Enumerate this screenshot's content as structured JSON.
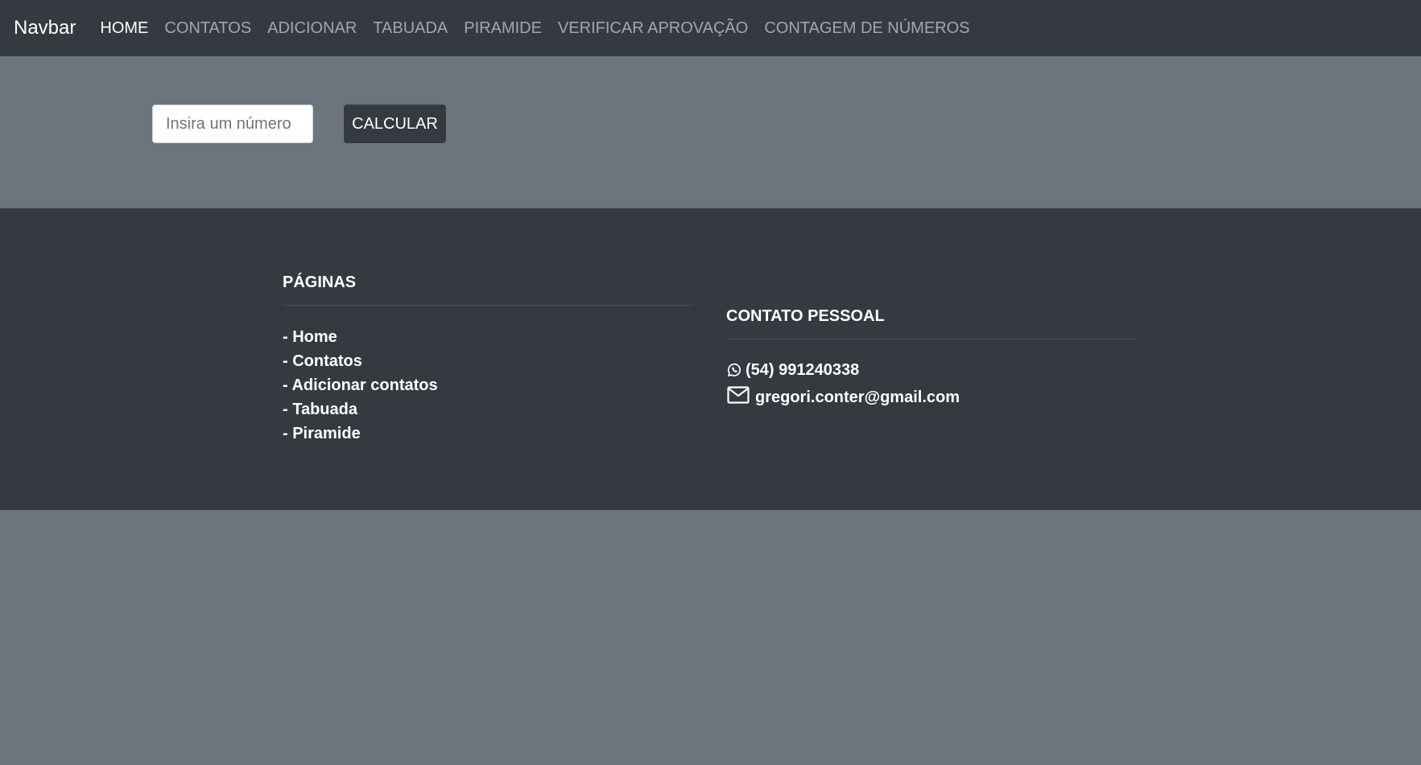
{
  "navbar": {
    "brand": "Navbar",
    "links": [
      {
        "label": "HOME",
        "active": true
      },
      {
        "label": "CONTATOS"
      },
      {
        "label": "ADICIONAR"
      },
      {
        "label": "TABUADA"
      },
      {
        "label": "PIRAMIDE"
      },
      {
        "label": "VERIFICAR APROVAÇÃO"
      },
      {
        "label": "CONTAGEM DE NÚMEROS"
      }
    ]
  },
  "form": {
    "number_placeholder": "Insira um número",
    "number_value": "",
    "calculate_label": "CALCULAR"
  },
  "footer": {
    "pages": {
      "heading": "PÁGINAS",
      "items": [
        "- Home",
        "- Contatos",
        "- Adicionar contatos",
        "- Tabuada",
        "- Piramide"
      ]
    },
    "contact": {
      "heading": "CONTATO PESSOAL",
      "phone": "(54) 991240338",
      "phone_icon": "whatsapp-icon",
      "email": "gregori.conter@gmail.com",
      "email_icon": "envelope-icon"
    }
  },
  "colors": {
    "page_background": "#6c757d",
    "navbar_background": "#343a40",
    "footer_background": "#343a40",
    "button_background": "#343a40",
    "nav_active": "#ffffff",
    "nav_inactive": "rgba(255,255,255,0.55)"
  }
}
